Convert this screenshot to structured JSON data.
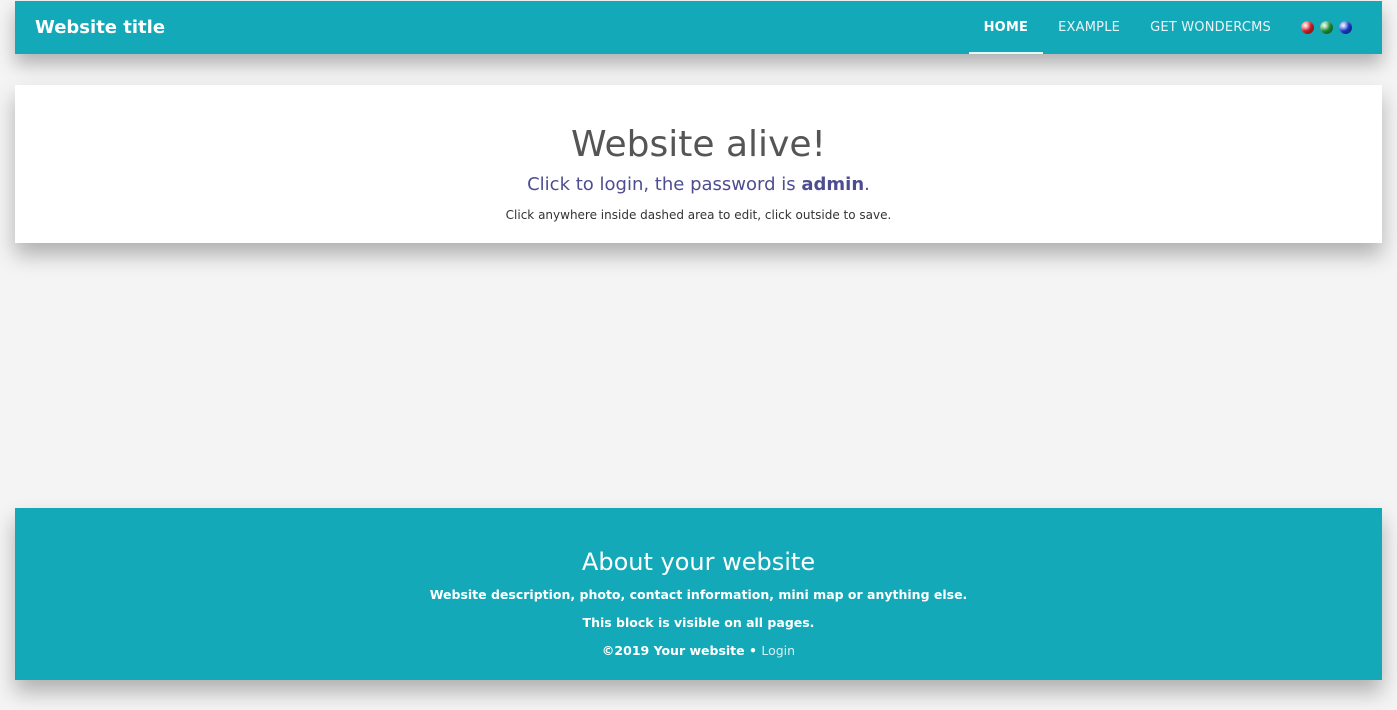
{
  "navbar": {
    "brand": "Website title",
    "items": [
      {
        "label": "HOME",
        "active": true
      },
      {
        "label": "EXAMPLE",
        "active": false
      },
      {
        "label": "GET WONDERCMS",
        "active": false
      }
    ],
    "flags": [
      {
        "icon": "globe-red-icon",
        "color": "#d9232b"
      },
      {
        "icon": "globe-green-icon",
        "color": "#1f9a3a"
      },
      {
        "icon": "globe-blue-icon",
        "color": "#1a3fd6"
      }
    ]
  },
  "main": {
    "title": "Website alive!",
    "subtitle_prefix": "Click to login, the password is ",
    "password": "admin",
    "subtitle_suffix": ".",
    "hint": "Click anywhere inside dashed area to edit, click outside to save."
  },
  "footer": {
    "title": "About your website",
    "description": "Website description, photo, contact information, mini map or anything else.",
    "visibility_note": "This block is visible on all pages.",
    "copyright": "©2019 Your website • ",
    "login_label": "Login"
  },
  "colors": {
    "accent": "#13a9b9",
    "heading": "#555555",
    "subtitle": "#4e4d91",
    "background": "#f4f4f4"
  }
}
